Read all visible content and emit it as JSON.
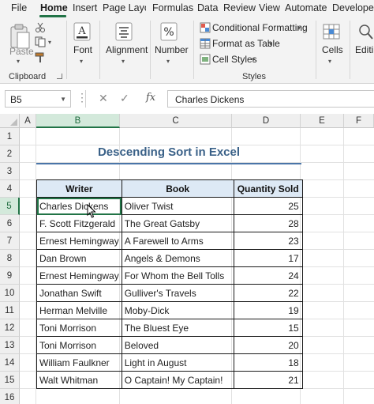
{
  "ribbon_tabs": [
    "File",
    "Home",
    "Insert",
    "Page Layout",
    "Formulas",
    "Data",
    "Review",
    "View",
    "Automate",
    "Developer"
  ],
  "active_tab": "Home",
  "ribbon": {
    "clipboard": {
      "paste_label": "Paste",
      "group_label": "Clipboard"
    },
    "font": {
      "label": "Font"
    },
    "alignment": {
      "label": "Alignment"
    },
    "number": {
      "label": "Number"
    },
    "styles": {
      "conditional_formatting": "Conditional Formatting",
      "format_as_table": "Format as Table",
      "cell_styles": "Cell Styles",
      "group_label": "Styles"
    },
    "cells": {
      "label": "Cells"
    },
    "editing": {
      "label": "Editi"
    }
  },
  "formula_bar": {
    "name_box": "B5",
    "fx": "fx",
    "content": "Charles Dickens"
  },
  "columns": [
    "A",
    "B",
    "C",
    "D",
    "E",
    "F"
  ],
  "selected_column": "B",
  "rows": [
    "1",
    "2",
    "3",
    "4",
    "5",
    "6",
    "7",
    "8",
    "9",
    "10",
    "11",
    "12",
    "13",
    "14",
    "15",
    "16"
  ],
  "selected_row": "5",
  "sheet": {
    "title": "Descending Sort in Excel",
    "headers": [
      "Writer",
      "Book",
      "Quantity Sold"
    ],
    "records": [
      [
        "Charles Dickens",
        "Oliver Twist",
        "25"
      ],
      [
        "F. Scott Fitzgerald",
        "The Great Gatsby",
        "28"
      ],
      [
        "Ernest Hemingway",
        "A Farewell to Arms",
        "23"
      ],
      [
        "Dan Brown",
        "Angels & Demons",
        "17"
      ],
      [
        "Ernest Hemingway",
        "For Whom the Bell Tolls",
        "24"
      ],
      [
        "Jonathan Swift",
        "Gulliver's Travels",
        "22"
      ],
      [
        "Herman Melville",
        "Moby-Dick",
        "19"
      ],
      [
        "Toni Morrison",
        "The Bluest Eye",
        "15"
      ],
      [
        "Toni Morrison",
        "Beloved",
        "20"
      ],
      [
        "William Faulkner",
        "Light in August",
        "18"
      ],
      [
        "Walt Whitman",
        "O Captain! My Captain!",
        "21"
      ]
    ]
  },
  "colors": {
    "excel_green": "#217346",
    "title_blue": "#3a6188",
    "header_fill": "#dde9f5"
  }
}
